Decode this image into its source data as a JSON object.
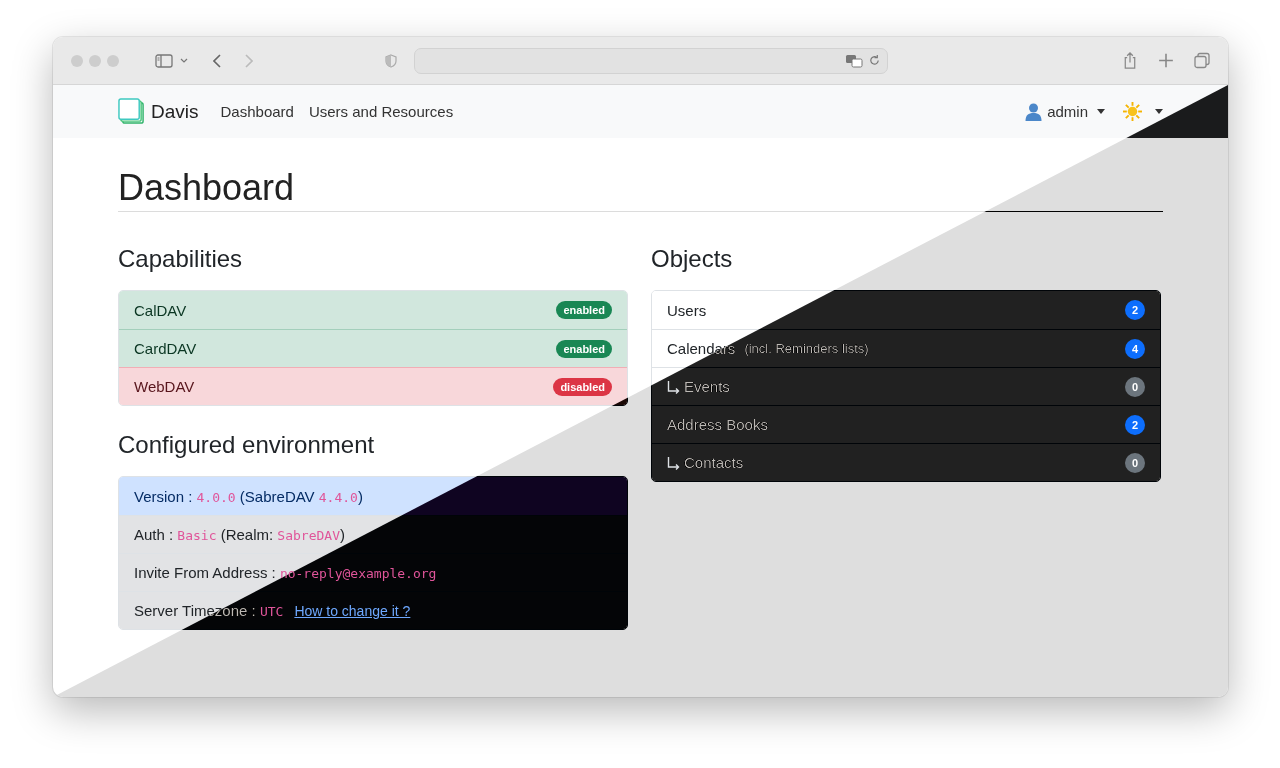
{
  "navbar": {
    "brand": "Davis",
    "links": [
      {
        "label": "Dashboard"
      },
      {
        "label": "Users and Resources"
      }
    ],
    "user": "admin"
  },
  "page_title": "Dashboard",
  "capabilities": {
    "title": "Capabilities",
    "items": [
      {
        "name": "CalDAV",
        "badge": "enabled",
        "enabled": true
      },
      {
        "name": "CardDAV",
        "badge": "enabled",
        "enabled": true
      },
      {
        "name": "WebDAV",
        "badge": "disabled",
        "enabled": false
      }
    ]
  },
  "environment": {
    "title": "Configured environment",
    "rows": [
      {
        "highlighted": true,
        "segments": [
          {
            "kind": "text",
            "text": "Version : "
          },
          {
            "kind": "code",
            "text": "4.0.0"
          },
          {
            "kind": "text",
            "text": " (SabreDAV "
          },
          {
            "kind": "code",
            "text": "4.4.0"
          },
          {
            "kind": "text",
            "text": ")"
          }
        ]
      },
      {
        "highlighted": false,
        "segments": [
          {
            "kind": "text",
            "text": "Auth : "
          },
          {
            "kind": "code",
            "text": "Basic"
          },
          {
            "kind": "text",
            "text": " (Realm: "
          },
          {
            "kind": "code",
            "text": "SabreDAV"
          },
          {
            "kind": "text",
            "text": ")"
          }
        ]
      },
      {
        "highlighted": false,
        "segments": [
          {
            "kind": "text",
            "text": "Invite From Address : "
          },
          {
            "kind": "code",
            "text": "no-reply@example.org"
          }
        ]
      },
      {
        "highlighted": false,
        "segments": [
          {
            "kind": "text",
            "text": "Server Timezone : "
          },
          {
            "kind": "code",
            "text": "UTC"
          },
          {
            "kind": "link",
            "text": "How to change it ?"
          }
        ]
      }
    ]
  },
  "objects": {
    "title": "Objects",
    "items": [
      {
        "label": "Users",
        "count": "2",
        "color": "#0d6efd"
      },
      {
        "label": "Calendars",
        "note": "(incl. Reminders lists)",
        "count": "4",
        "color": "#0d6efd",
        "children": [
          {
            "label": "Events",
            "count": "0",
            "color": "#6c757d"
          }
        ]
      },
      {
        "label": "Address Books",
        "count": "2",
        "color": "#0d6efd",
        "children": [
          {
            "label": "Contacts",
            "count": "0",
            "color": "#6c757d"
          }
        ]
      }
    ]
  }
}
